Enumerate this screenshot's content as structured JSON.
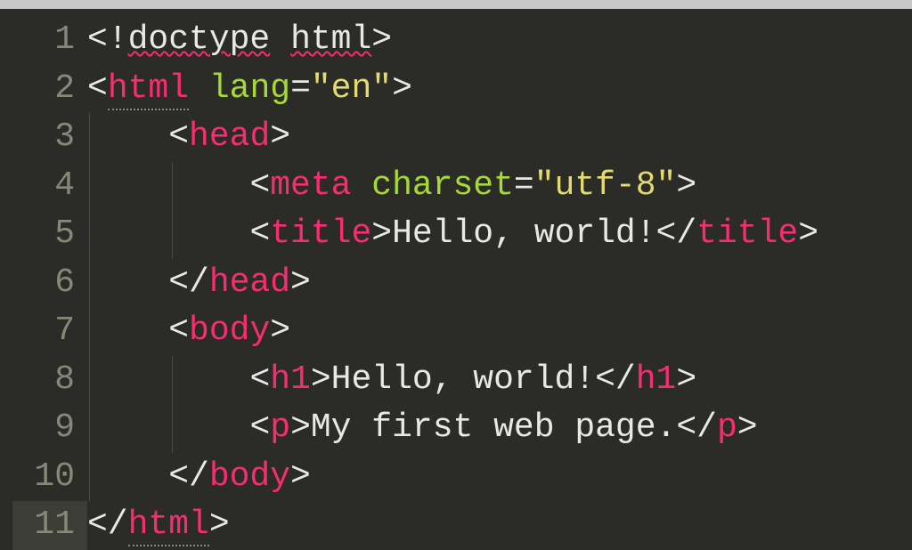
{
  "editor": {
    "lines": [
      {
        "num": "1"
      },
      {
        "num": "2"
      },
      {
        "num": "3"
      },
      {
        "num": "4"
      },
      {
        "num": "5"
      },
      {
        "num": "6"
      },
      {
        "num": "7"
      },
      {
        "num": "8"
      },
      {
        "num": "9"
      },
      {
        "num": "10"
      },
      {
        "num": "11"
      }
    ],
    "tokens": {
      "l1_open": "<!",
      "l1_doctype": "doctype",
      "l1_space": " ",
      "l1_html": "html",
      "l1_close": ">",
      "l2_open": "<",
      "l2_tag": "html",
      "l2_attr": " lang",
      "l2_eq": "=",
      "l2_str": "\"en\"",
      "l2_close": ">",
      "l3_open": "<",
      "l3_tag": "head",
      "l3_close": ">",
      "l4_open": "<",
      "l4_tag": "meta",
      "l4_attr": " charset",
      "l4_eq": "=",
      "l4_str": "\"utf-8\"",
      "l4_close": ">",
      "l5_open": "<",
      "l5_tag": "title",
      "l5_close1": ">",
      "l5_text": "Hello, world!",
      "l5_open2": "</",
      "l5_tag2": "title",
      "l5_close2": ">",
      "l6_open": "</",
      "l6_tag": "head",
      "l6_close": ">",
      "l7_open": "<",
      "l7_tag": "body",
      "l7_close": ">",
      "l8_open": "<",
      "l8_tag": "h1",
      "l8_close1": ">",
      "l8_text": "Hello, world!",
      "l8_open2": "</",
      "l8_tag2": "h1",
      "l8_close2": ">",
      "l9_open": "<",
      "l9_tag": "p",
      "l9_close1": ">",
      "l9_text": "My first web page.",
      "l9_open2": "</",
      "l9_tag2": "p",
      "l9_close2": ">",
      "l10_open": "</",
      "l10_tag": "body",
      "l10_close": ">",
      "l11_open": "</",
      "l11_tag": "html",
      "l11_close": ">"
    },
    "indent1": "    ",
    "indent2": "        "
  }
}
